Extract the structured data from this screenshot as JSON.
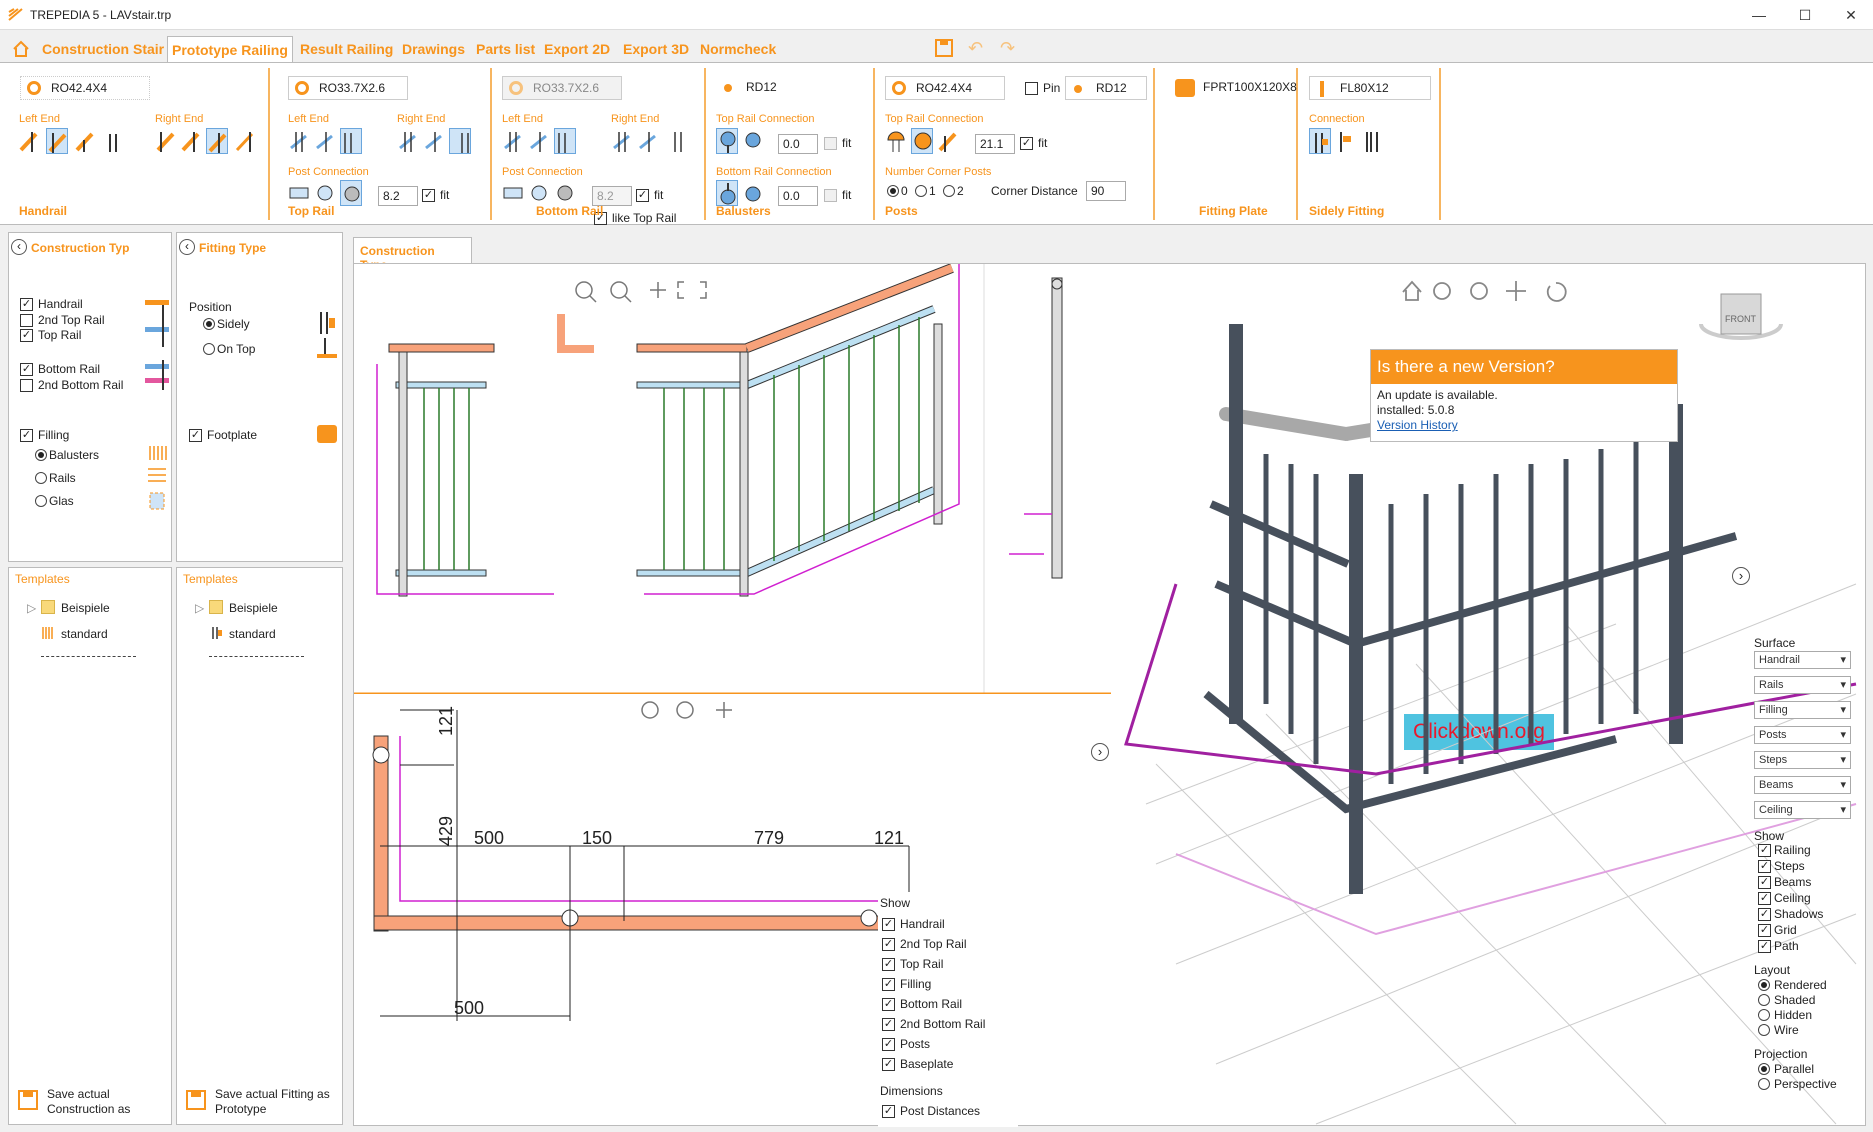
{
  "window": {
    "title": "TREPEDIA 5 - LAVstair.trp",
    "minimize": "—",
    "maximize": "☐",
    "close": "✕"
  },
  "menu": {
    "tabs": [
      "Construction Stair",
      "Prototype Railing",
      "Result Railing",
      "Drawings",
      "Parts list",
      "Export 2D",
      "Export 3D",
      "Normcheck"
    ]
  },
  "ribbon": {
    "handrail": {
      "profile": "RO42.4X4",
      "left_end": "Left End",
      "right_end": "Right End",
      "label": "Handrail"
    },
    "top_rail": {
      "profile": "RO33.7X2.6",
      "left_end": "Left End",
      "right_end": "Right End",
      "post_connection": "Post Connection",
      "value": "8.2",
      "fit": "fit",
      "label": "Top Rail"
    },
    "bottom_rail": {
      "profile": "RO33.7X2.6",
      "left_end": "Left End",
      "right_end": "Right End",
      "post_connection": "Post Connection",
      "value": "8.2",
      "fit": "fit",
      "like_top": "like Top Rail",
      "label": "Bottom Rail"
    },
    "balusters": {
      "profile": "RD12",
      "top_conn": "Top Rail Connection",
      "top_value": "0.0",
      "bottom_conn": "Bottom Rail Connection",
      "bottom_value": "0.0",
      "fit": "fit",
      "label": "Balusters"
    },
    "posts": {
      "profile": "RO42.4X4",
      "pin": "Pin",
      "pin_profile": "RD12",
      "top_conn": "Top Rail Connection",
      "top_value": "21.1",
      "fit": "fit",
      "corner_posts": "Number Corner Posts",
      "opts": [
        "0",
        "1",
        "2"
      ],
      "corner_distance_label": "Corner Distance",
      "corner_distance": "90",
      "label": "Posts"
    },
    "fitting_plate": {
      "profile": "FPRT100X120X8",
      "label": "Fitting Plate"
    },
    "sidely_fitting": {
      "profile": "FL80X12",
      "connection": "Connection",
      "label": "Sidely Fitting"
    }
  },
  "left_panel": {
    "title": "Construction Typ",
    "items": [
      "Handrail",
      "2nd Top Rail",
      "Top Rail",
      "Bottom Rail",
      "2nd Bottom Rail",
      "Filling"
    ],
    "checked": [
      true,
      false,
      true,
      true,
      false,
      true
    ],
    "filling_opts": [
      "Balusters",
      "Rails",
      "Glas"
    ],
    "templates": "Templates",
    "tree": [
      "Beispiele",
      "standard"
    ],
    "save": "Save actual Construction as"
  },
  "fitting_panel": {
    "title": "Fitting Type",
    "position": "Position",
    "opts": [
      "Sidely",
      "On Top"
    ],
    "footplate": "Footplate",
    "templates": "Templates",
    "tree": [
      "Beispiele",
      "standard"
    ],
    "save": "Save actual Fitting as Prototype"
  },
  "center": {
    "tab": "Construction Type",
    "dims": {
      "d121": "121",
      "d429": "429",
      "d500": "500",
      "d150": "150",
      "d779": "779",
      "d121b": "121",
      "d500b": "500"
    },
    "show": {
      "title": "Show",
      "items": [
        "Handrail",
        "2nd Top Rail",
        "Top Rail",
        "Filling",
        "Bottom Rail",
        "2nd Bottom Rail",
        "Posts",
        "Baseplate"
      ]
    },
    "dimensions": {
      "title": "Dimensions",
      "item": "Post Distances"
    }
  },
  "update_popup": {
    "title": "Is there a new Version?",
    "line1": "An update is available.",
    "line2": "installed: 5.0.8",
    "link": "Version History"
  },
  "watermark": "Clickdown.org",
  "right_controls": {
    "surface": "Surface",
    "selects": [
      "Handrail",
      "Rails",
      "Filling",
      "Posts",
      "Steps",
      "Beams",
      "Ceiling"
    ],
    "show": "Show",
    "show_items": [
      "Railing",
      "Steps",
      "Beams",
      "Ceiling",
      "Shadows",
      "Grid",
      "Path"
    ],
    "layout": "Layout",
    "layout_opts": [
      "Rendered",
      "Shaded",
      "Hidden",
      "Wire"
    ],
    "projection": "Projection",
    "proj_opts": [
      "Parallel",
      "Perspective"
    ],
    "cube": "FRONT"
  }
}
